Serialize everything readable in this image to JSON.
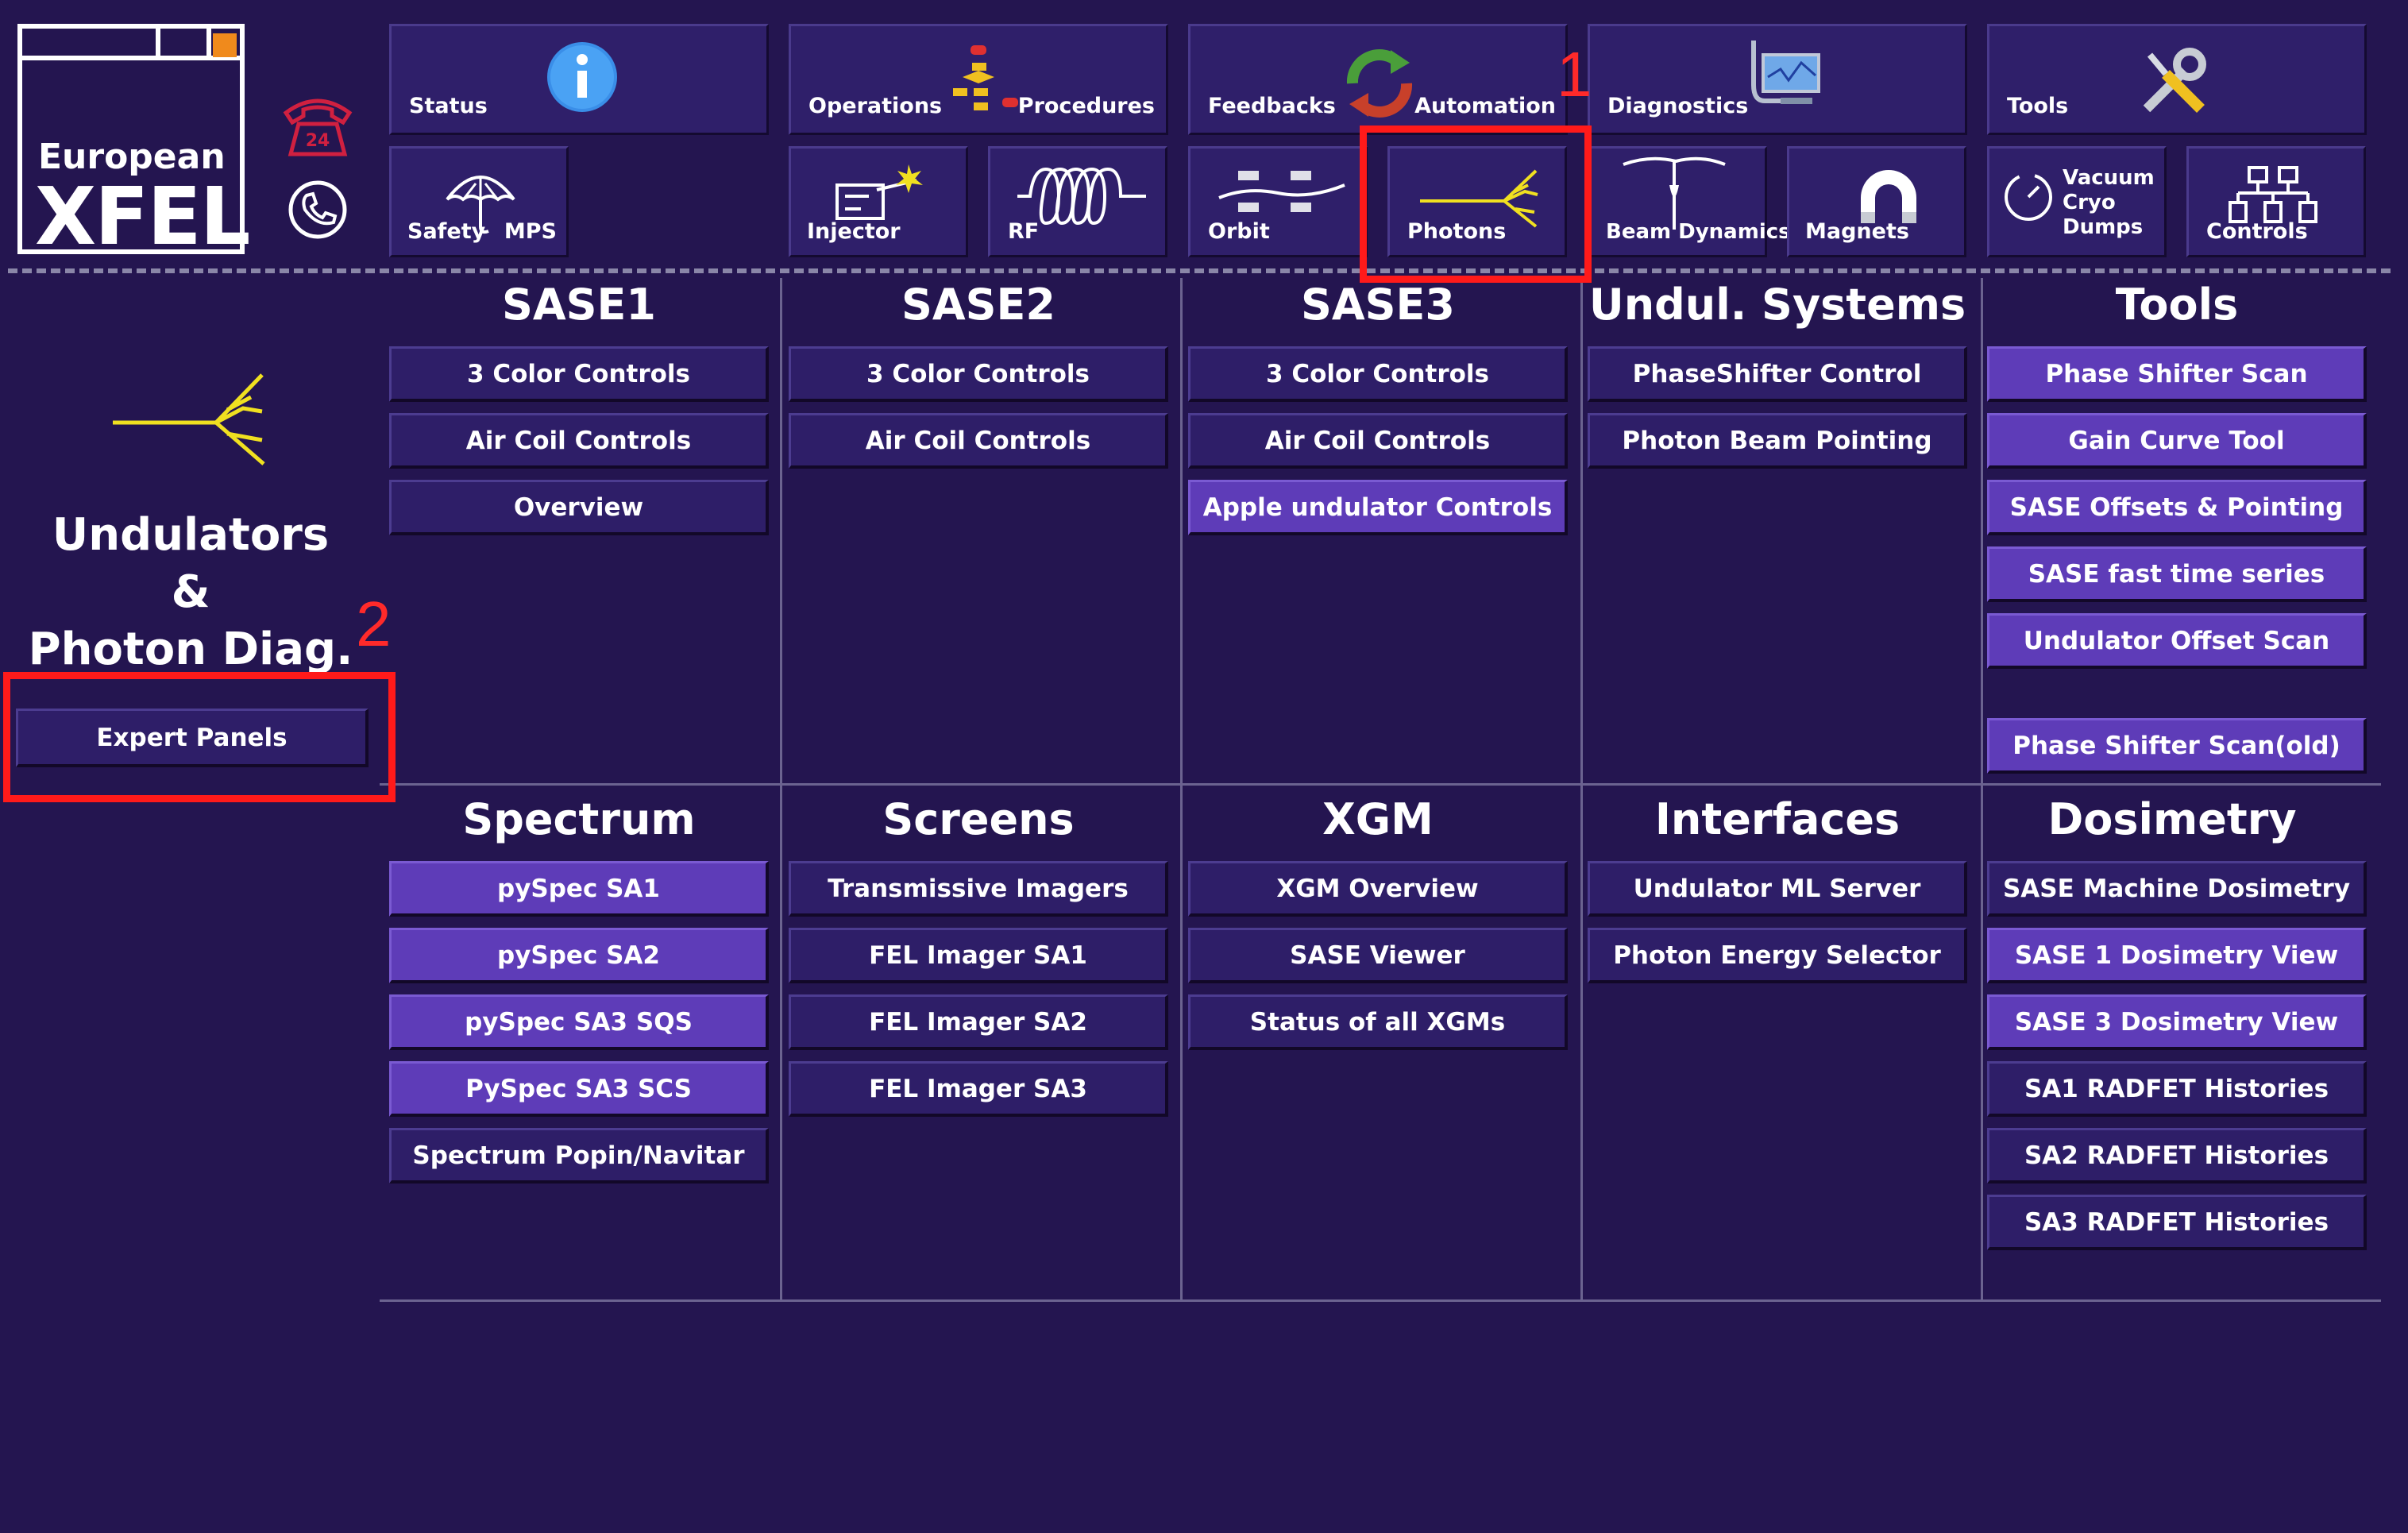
{
  "logo": {
    "line1": "European",
    "line2": "XFEL"
  },
  "top_tiles": [
    {
      "id": "status",
      "label": "Status",
      "icon": "info-icon"
    },
    {
      "id": "operations",
      "label": "Operations",
      "icon": "flowchart-icon"
    },
    {
      "id": "procedures",
      "label": "Procedures",
      "icon": "flowchart-icon"
    },
    {
      "id": "feedbacks",
      "label": "Feedbacks",
      "icon": "cycle-arrows-icon"
    },
    {
      "id": "automation",
      "label": "Automation",
      "icon": "cycle-arrows-icon"
    },
    {
      "id": "diagnostics",
      "label": "Diagnostics",
      "icon": "monitor-icon"
    },
    {
      "id": "tools",
      "label": "Tools",
      "icon": "wrench-screwdriver-icon"
    },
    {
      "id": "safety",
      "label": "Safety",
      "icon": "umbrella-icon"
    },
    {
      "id": "mps",
      "label": "MPS",
      "icon": "umbrella-icon"
    },
    {
      "id": "injector",
      "label": "Injector",
      "icon": "injector-icon"
    },
    {
      "id": "rf",
      "label": "RF",
      "icon": "coil-icon"
    },
    {
      "id": "orbit",
      "label": "Orbit",
      "icon": "orbit-icon"
    },
    {
      "id": "photons",
      "label": "Photons",
      "icon": "photon-beam-icon"
    },
    {
      "id": "beam_dynamics",
      "label": "Beam Dynamics",
      "icon": "beam-dynamics-icon"
    },
    {
      "id": "magnets",
      "label": "Magnets",
      "icon": "magnet-icon"
    },
    {
      "id": "vacuum",
      "label_lines": [
        "Vacuum",
        "Cryo",
        "Dumps"
      ],
      "icon": "gauge-icon"
    },
    {
      "id": "controls",
      "label": "Controls",
      "icon": "network-icon"
    }
  ],
  "left_panel": {
    "title_lines": [
      "Undulators",
      "&",
      "Photon Diag."
    ],
    "expert_button": "Expert Panels"
  },
  "annotations": {
    "marker1": "1",
    "marker2": "2"
  },
  "sections_top": [
    {
      "title": "SASE1",
      "buttons": [
        {
          "label": "3 Color Controls",
          "highlight": false
        },
        {
          "label": "Air Coil Controls",
          "highlight": false
        },
        {
          "label": "Overview",
          "highlight": false
        }
      ]
    },
    {
      "title": "SASE2",
      "buttons": [
        {
          "label": "3 Color Controls",
          "highlight": false
        },
        {
          "label": "Air Coil Controls",
          "highlight": false
        }
      ]
    },
    {
      "title": "SASE3",
      "buttons": [
        {
          "label": "3 Color Controls",
          "highlight": false
        },
        {
          "label": "Air Coil Controls",
          "highlight": false
        },
        {
          "label": "Apple undulator Controls",
          "highlight": true
        }
      ]
    },
    {
      "title": "Undul. Systems",
      "buttons": [
        {
          "label": "PhaseShifter Control",
          "highlight": false
        },
        {
          "label": "Photon Beam Pointing",
          "highlight": false
        }
      ]
    },
    {
      "title": "Tools",
      "buttons": [
        {
          "label": "Phase Shifter Scan",
          "highlight": true
        },
        {
          "label": "Gain Curve Tool",
          "highlight": true
        },
        {
          "label": "SASE Offsets & Pointing",
          "highlight": true
        },
        {
          "label": "SASE fast time series",
          "highlight": true
        },
        {
          "label": "Undulator Offset Scan",
          "highlight": true
        },
        {
          "label": "Phase Shifter Scan(old)",
          "highlight": true
        }
      ]
    }
  ],
  "sections_bottom": [
    {
      "title": "Spectrum",
      "buttons": [
        {
          "label": "pySpec SA1",
          "highlight": true
        },
        {
          "label": "pySpec SA2",
          "highlight": true
        },
        {
          "label": "pySpec SA3 SQS",
          "highlight": true
        },
        {
          "label": "PySpec SA3 SCS",
          "highlight": true
        },
        {
          "label": "Spectrum Popin/Navitar",
          "highlight": false
        }
      ]
    },
    {
      "title": "Screens",
      "buttons": [
        {
          "label": "Transmissive Imagers",
          "highlight": false
        },
        {
          "label": "FEL Imager SA1",
          "highlight": false
        },
        {
          "label": "FEL Imager SA2",
          "highlight": false
        },
        {
          "label": "FEL Imager SA3",
          "highlight": false
        }
      ]
    },
    {
      "title": "XGM",
      "buttons": [
        {
          "label": "XGM Overview",
          "highlight": false
        },
        {
          "label": "SASE Viewer",
          "highlight": false
        },
        {
          "label": "Status of all XGMs",
          "highlight": false
        }
      ]
    },
    {
      "title": "Interfaces",
      "buttons": [
        {
          "label": "Undulator ML Server",
          "highlight": false
        },
        {
          "label": "Photon Energy Selector",
          "highlight": false
        }
      ]
    },
    {
      "title": "Dosimetry",
      "buttons": [
        {
          "label": "SASE Machine Dosimetry",
          "highlight": false
        },
        {
          "label": "SASE 1 Dosimetry View",
          "highlight": true
        },
        {
          "label": "SASE 3 Dosimetry View",
          "highlight": true
        },
        {
          "label": "SA1 RADFET Histories",
          "highlight": false
        },
        {
          "label": "SA2 RADFET Histories",
          "highlight": false
        },
        {
          "label": "SA3 RADFET Histories",
          "highlight": false
        }
      ]
    }
  ],
  "colors": {
    "background": "#241550",
    "button": "#2e1e68",
    "button_highlight": "#5e3cb8",
    "annotation": "#ff1a1a",
    "photon_icon": "#f0e020"
  }
}
